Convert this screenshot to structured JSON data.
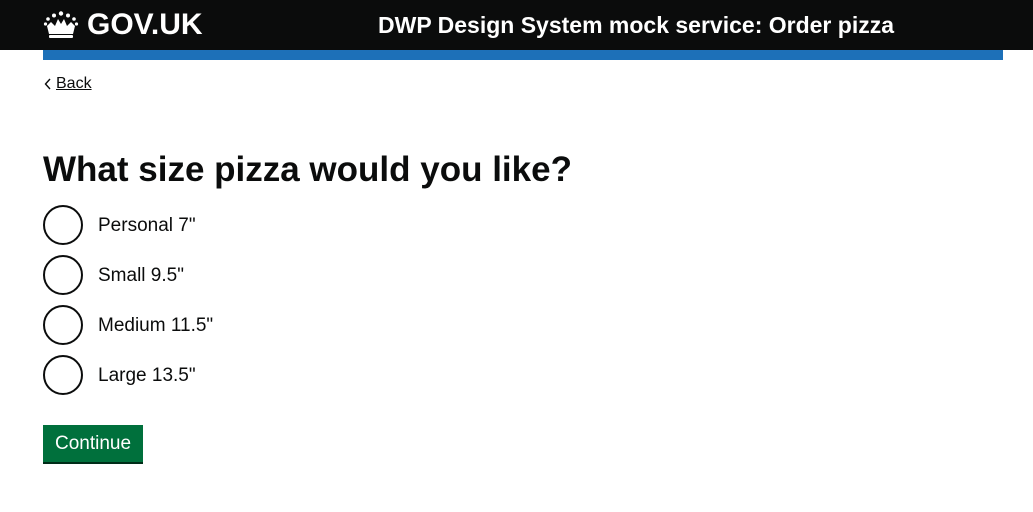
{
  "header": {
    "logo_text": "GOV.UK",
    "logo_icon": "crown-icon",
    "service_name": "DWP Design System mock service: Order pizza",
    "background_color": "#0b0c0c",
    "accent_bar_color": "#1d70b8"
  },
  "navigation": {
    "back_label": "Back",
    "back_icon": "chevron-left-icon"
  },
  "question": {
    "heading": "What size pizza would you like?",
    "options": [
      {
        "label": "Personal 7\"",
        "selected": false
      },
      {
        "label": "Small 9.5\"",
        "selected": false
      },
      {
        "label": "Medium 11.5\"",
        "selected": false
      },
      {
        "label": "Large 13.5\"",
        "selected": false
      }
    ]
  },
  "actions": {
    "continue_label": "Continue",
    "continue_color": "#00703c"
  }
}
